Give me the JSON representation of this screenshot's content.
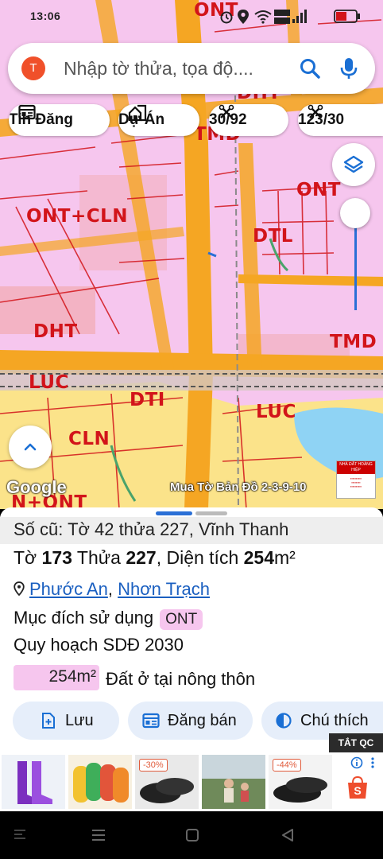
{
  "status_bar": {
    "time": "13:06"
  },
  "search": {
    "avatar_letter": "T",
    "placeholder": "Nhập tờ thửa, tọa độ...."
  },
  "chips": [
    {
      "label": "Tin Đăng",
      "icon": "news-icon"
    },
    {
      "label": "Dự Án",
      "icon": "building-icon"
    },
    {
      "label": "30/92",
      "icon": "scissors-icon"
    },
    {
      "label": "123/30",
      "icon": "scissors-icon"
    }
  ],
  "map": {
    "zones": [
      {
        "label": "ONT"
      },
      {
        "label": "DHT"
      },
      {
        "label": "TMD"
      },
      {
        "label": "ONT"
      },
      {
        "label": "ONT+CLN"
      },
      {
        "label": "DTL"
      },
      {
        "label": "DHT"
      },
      {
        "label": "TMD"
      },
      {
        "label": "LUC"
      },
      {
        "label": "DTI"
      },
      {
        "label": "LUC"
      },
      {
        "label": "CLN"
      },
      {
        "label": "N+ONT"
      }
    ],
    "google_label": "Google",
    "overlay_note": "Mua Tờ Bản Đồ 2-3-9-10",
    "promo_text": "NHÀ ĐẤT HOÀNG HIỆP",
    "colors": {
      "ont": "#f6c6ee",
      "road": "#f5a623",
      "cln": "#fbe38a",
      "boundary": "#d2141a",
      "water": "#8fd3f4"
    }
  },
  "sheet": {
    "old_number": "Số cũ: Tờ 42 thửa 227, Vĩnh Thanh",
    "parcel": {
      "sheet_prefix": "Tờ",
      "sheet_no": "173",
      "lot_prefix": "Thửa",
      "lot_no": "227",
      "area_prefix": ", Diện tích",
      "area": "254",
      "unit": "m²"
    },
    "location": {
      "ward": "Phước An",
      "separator": ", ",
      "district": "Nhơn Trạch"
    },
    "purpose_label": "Mục đích sử dụng",
    "purpose_code": "ONT",
    "plan_label": "Quy hoạch SDĐ 2030",
    "area_value": "254m²",
    "area_desc": "Đất ở tại nông thôn",
    "buttons": {
      "save": "Lưu",
      "post": "Đăng bán",
      "legend": "Chú thích"
    }
  },
  "ads": {
    "close_label": "TẮT QC",
    "discount_1": "-30%",
    "discount_2": "-44%"
  }
}
